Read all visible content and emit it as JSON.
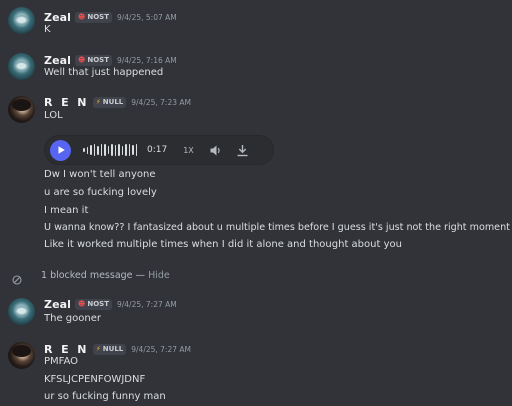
{
  "messages": [
    {
      "author": "Zeal",
      "tag": "NOST",
      "tag_glyph": "☻",
      "timestamp": "9/4/25, 5:07 AM",
      "lines": [
        "K"
      ]
    },
    {
      "author": "Zeal",
      "tag": "NOST",
      "tag_glyph": "☻",
      "timestamp": "9/4/25, 7:16 AM",
      "lines": [
        "Well that just happened"
      ]
    },
    {
      "author": "R E N",
      "tag": "NULL",
      "tag_glyph": "⚡",
      "timestamp": "9/4/25, 7:23 AM",
      "lines": [
        "LOL"
      ],
      "audio": {
        "duration": "0:17",
        "speed": "1X"
      },
      "after_lines": [
        "Dw I won't tell anyone",
        "u are so fucking lovely",
        "I mean it",
        "U wanna know?? I fantasized about u multiple times before I guess it's just not the right moment",
        "Like it worked multiple times when I did it alone and thought about you"
      ]
    },
    {
      "author": "Zeal",
      "tag": "NOST",
      "tag_glyph": "☻",
      "timestamp": "9/4/25, 7:27 AM",
      "lines": [
        "The gooner"
      ]
    },
    {
      "author": "R E N",
      "tag": "NULL",
      "tag_glyph": "⚡",
      "timestamp": "9/4/25, 7:27 AM",
      "lines": [
        "PMFAO",
        "KFSLJCPENFOWJDNF",
        "ur so fucking funny man"
      ]
    }
  ],
  "blocked": {
    "text": "1 blocked message — ",
    "hide_label": "Hide"
  },
  "colors": {
    "background": "#313338",
    "accent": "#5865f2",
    "muted": "#949ba4"
  },
  "icons": [
    "play-icon",
    "volume-icon",
    "download-icon",
    "blocked-icon"
  ]
}
